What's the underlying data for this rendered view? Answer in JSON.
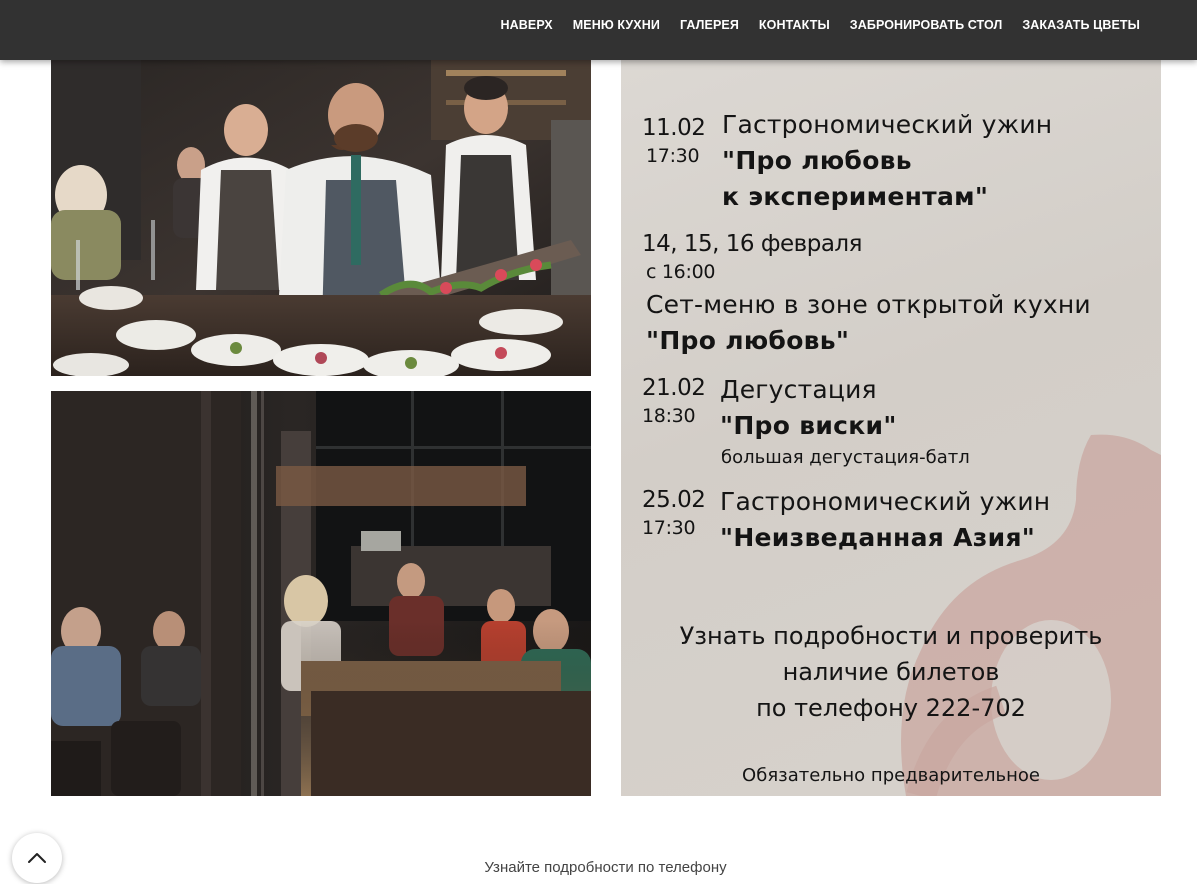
{
  "nav": {
    "items": [
      {
        "label": "НАВЕРХ",
        "name": "nav-item-top"
      },
      {
        "label": "МЕНЮ КУХНИ",
        "name": "nav-item-menu"
      },
      {
        "label": "ГАЛЕРЕЯ",
        "name": "nav-item-gallery"
      },
      {
        "label": "КОНТАКТЫ",
        "name": "nav-item-contacts"
      },
      {
        "label": "ЗАБРОНИРОВАТЬ СТОЛ",
        "name": "nav-item-book-table"
      },
      {
        "label": "ЗАКАЗАТЬ ЦВЕТЫ",
        "name": "nav-item-order-flowers"
      }
    ]
  },
  "poster": {
    "events": [
      {
        "date": "11.02",
        "time": "17:30",
        "type": "Гастрономический ужин",
        "title_line1": "\"Про любовь",
        "title_line2": "к экспериментам\""
      },
      {
        "date": "14, 15, 16 февраля",
        "time": "с 16:00",
        "type": "Сет-меню в зоне открытой кухни",
        "title": "\"Про любовь\""
      },
      {
        "date": "21.02",
        "time": "18:30",
        "type": "Дегустация",
        "title": "\"Про виски\"",
        "subtitle": "большая дегустация-батл"
      },
      {
        "date": "25.02",
        "time": "17:30",
        "type": "Гастрономический ужин",
        "title": "\"Неизведанная Азия\""
      }
    ],
    "info_line1": "Узнать подробности и проверить",
    "info_line2": "наличие билетов",
    "info_line3": "по телефону 222-702",
    "note": "Обязательно предварительное"
  },
  "footer": {
    "text": "Узнайте подробности по телефону"
  },
  "icons": {
    "scroll_top": "chevron-up-icon"
  },
  "colors": {
    "topbar": "#323232",
    "poster_bg": "#d6d1cb",
    "poster_deco": "#c9a7a0"
  }
}
